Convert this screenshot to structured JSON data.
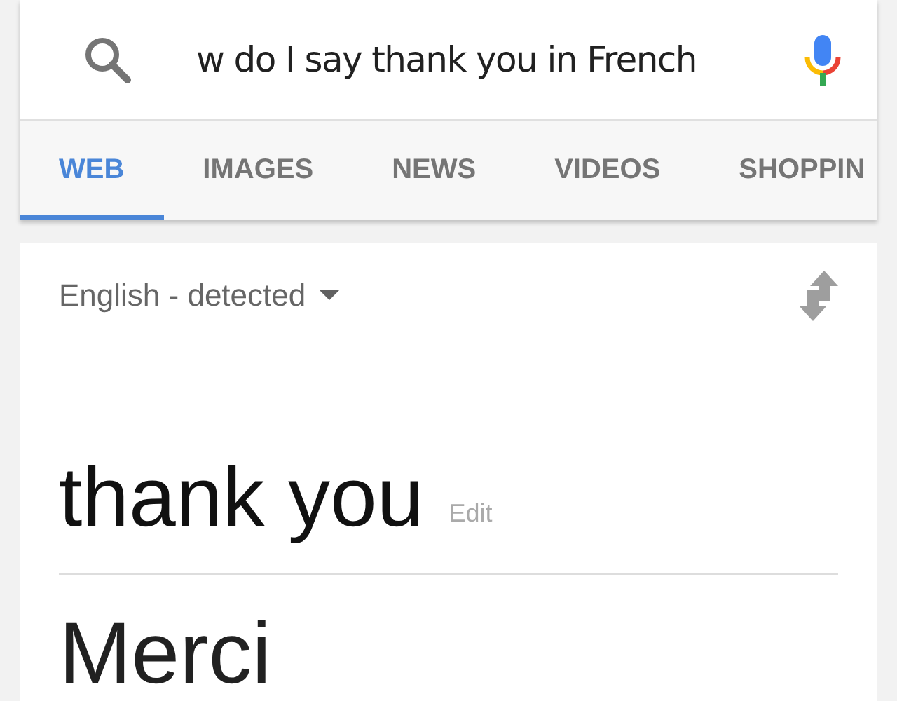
{
  "search": {
    "value": "w do I say thank you in French"
  },
  "tabs": [
    {
      "label": "WEB",
      "selected": true
    },
    {
      "label": "IMAGES",
      "selected": false
    },
    {
      "label": "NEWS",
      "selected": false
    },
    {
      "label": "VIDEOS",
      "selected": false
    },
    {
      "label": "SHOPPIN",
      "selected": false
    }
  ],
  "translate": {
    "source_language": "English - detected",
    "source_text": "thank you",
    "edit_link": "Edit",
    "translation": "Merci"
  }
}
